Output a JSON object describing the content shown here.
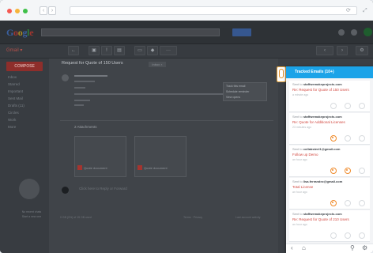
{
  "browser": {
    "back": "‹",
    "forward": "›",
    "url_icons": [
      "refresh-icon",
      "expand-icon"
    ]
  },
  "gmail": {
    "logo": "Google",
    "mail_label": "Gmail ▾",
    "compose": "COMPOSE",
    "sidebar": [
      "Inbox",
      "Starred",
      "Important",
      "Sent Mail",
      "Drafts (11)",
      "Circles",
      "Work",
      "More"
    ],
    "subject": "Request for Quote of 150 Users",
    "inbox_tag": "Inbox ×",
    "attachments_label": "2 Attachments",
    "attachments": [
      {
        "name": "Quote document"
      },
      {
        "name": "Quote document"
      }
    ],
    "reply_placeholder": "Click here to Reply or Forward",
    "footer": [
      "0 GB (0%) of 15 GB used",
      "Terms · Privacy",
      "Last account activity"
    ],
    "context_menu": [
      "Track this email",
      "Schedule reminder",
      "View opens"
    ],
    "hangouts": [
      "No recent chats",
      "Start a new one"
    ]
  },
  "tracker": {
    "title": "Tracked Emails (10+)",
    "emails": [
      {
        "to": "staffwemakeprojects.com",
        "subject": "Re: Request for Quote of 150 Users",
        "time": "a minute ago",
        "status": [
          false,
          false,
          false
        ]
      },
      {
        "to": "staffwemakeprojects.com",
        "subject": "Re: Quote for Additional Licenses",
        "time": "23 minutes ago",
        "status": [
          true,
          false,
          false
        ]
      },
      {
        "to": "collabsteel1@gmail.com",
        "subject": "Follow up Demo",
        "time": "an hour ago",
        "status": [
          true,
          true,
          false
        ]
      },
      {
        "to": "lisa.ferrandez@gmail.com",
        "subject": "Total License",
        "time": "an hour ago",
        "status": [
          true,
          false,
          false
        ]
      },
      {
        "to": "staffwemakeprojects.com",
        "subject": "Re: Request for Quote of 210 Users",
        "time": "an hour ago",
        "status": [
          false,
          false,
          false
        ]
      }
    ],
    "sent_prefix": "Sent to"
  },
  "colors": {
    "accent": "#1ba3e8",
    "open": "#ef8a2a",
    "subject": "#d2473f"
  }
}
